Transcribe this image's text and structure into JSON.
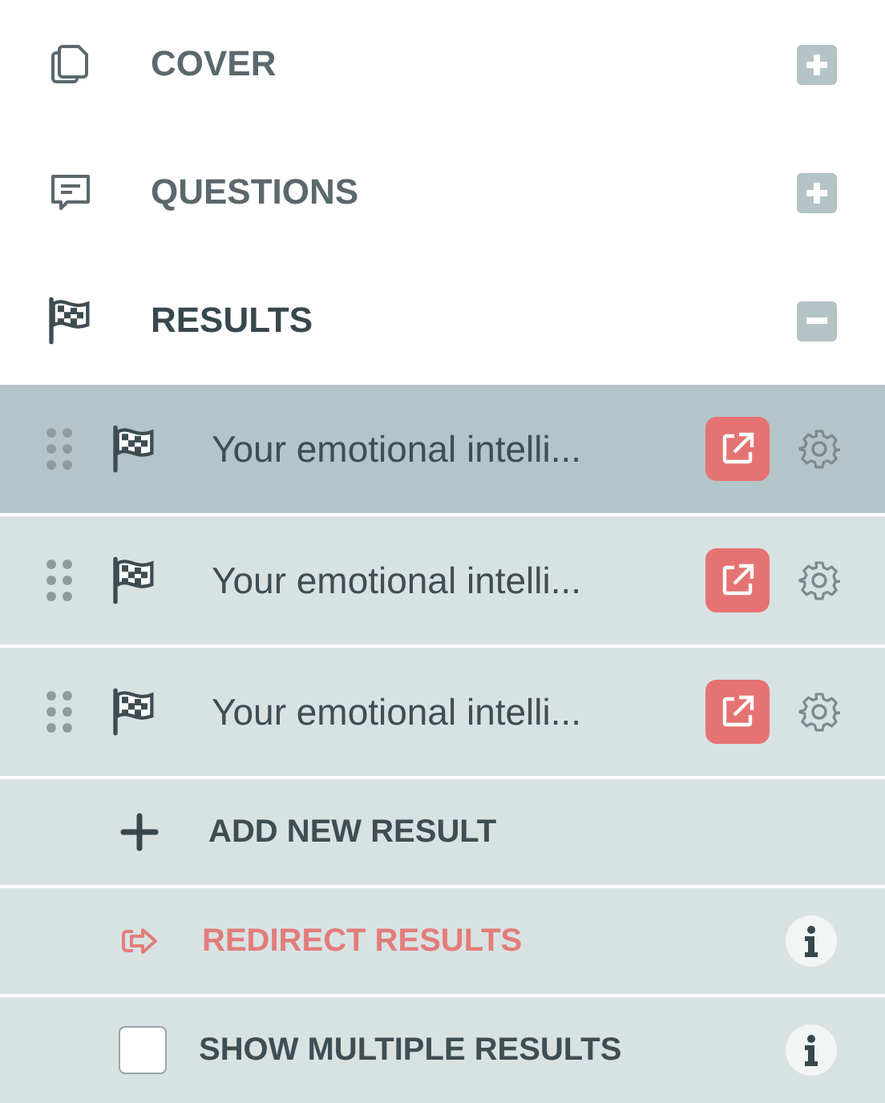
{
  "sections": [
    {
      "kind": "cover",
      "title": "COVER",
      "expanded": false
    },
    {
      "kind": "questions",
      "title": "QUESTIONS",
      "expanded": false
    },
    {
      "kind": "results",
      "title": "RESULTS",
      "expanded": true
    }
  ],
  "results": [
    {
      "title": "Your emotional intelli...",
      "selected": true
    },
    {
      "title": "Your emotional intelli...",
      "selected": false
    },
    {
      "title": "Your emotional intelli...",
      "selected": false
    }
  ],
  "actions": [
    {
      "kind": "add",
      "label": "ADD NEW RESULT"
    },
    {
      "kind": "redirect",
      "label": "REDIRECT RESULTS"
    },
    {
      "kind": "checkbox",
      "label": "SHOW MULTIPLE RESULTS",
      "checked": false
    }
  ]
}
